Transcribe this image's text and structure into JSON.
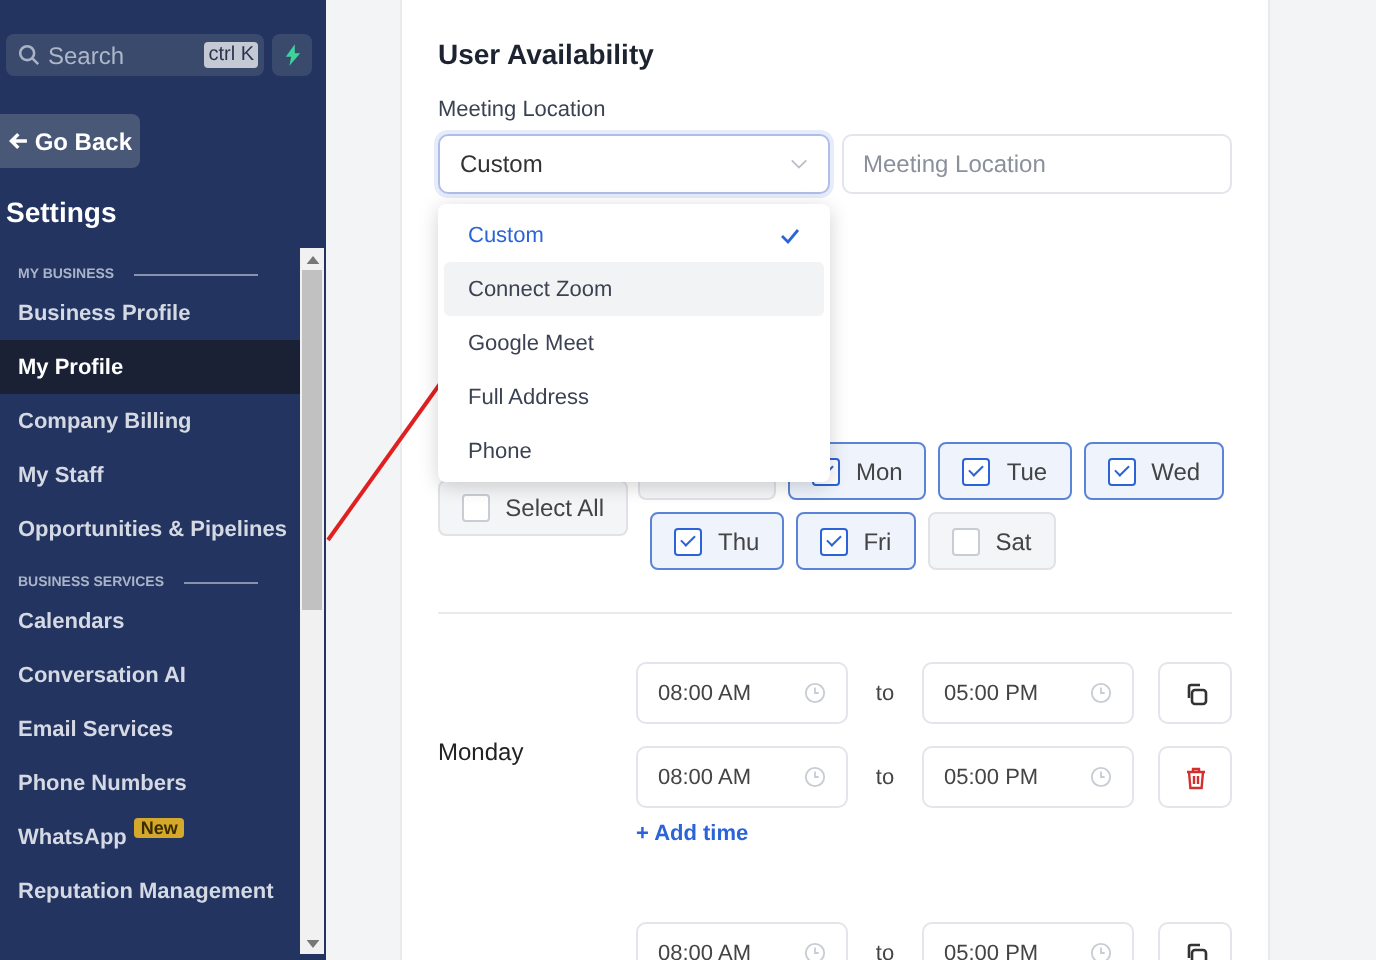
{
  "sidebar": {
    "search": {
      "placeholder": "Search",
      "shortcut": "ctrl K"
    },
    "back_button": "Go Back",
    "heading": "Settings",
    "sections": [
      {
        "title": "MY BUSINESS",
        "items": [
          {
            "label": "Business Profile",
            "selected": false
          },
          {
            "label": "My Profile",
            "selected": true
          },
          {
            "label": "Company Billing",
            "selected": false
          },
          {
            "label": "My Staff",
            "selected": false
          },
          {
            "label": "Opportunities & Pipelines",
            "selected": false
          }
        ]
      },
      {
        "title": "BUSINESS SERVICES",
        "items": [
          {
            "label": "Calendars",
            "selected": false
          },
          {
            "label": "Conversation AI",
            "selected": false
          },
          {
            "label": "Email Services",
            "selected": false
          },
          {
            "label": "Phone Numbers",
            "selected": false
          },
          {
            "label": "WhatsApp",
            "selected": false,
            "badge": "New"
          },
          {
            "label": "Reputation Management",
            "selected": false
          }
        ]
      }
    ]
  },
  "main": {
    "title": "User Availability",
    "meeting_location": {
      "label": "Meeting Location",
      "select_value": "Custom",
      "input_placeholder": "Meeting Location"
    },
    "dropdown": {
      "options": [
        {
          "label": "Custom",
          "selected": true,
          "highlighted": false
        },
        {
          "label": "Connect Zoom",
          "selected": false,
          "highlighted": true
        },
        {
          "label": "Google Meet",
          "selected": false,
          "highlighted": false
        },
        {
          "label": "Full Address",
          "selected": false,
          "highlighted": false
        },
        {
          "label": "Phone",
          "selected": false,
          "highlighted": false
        }
      ]
    },
    "select_all": {
      "label": "Select All",
      "checked": false
    },
    "days": [
      {
        "label": "Mon",
        "checked": true
      },
      {
        "label": "Tue",
        "checked": true
      },
      {
        "label": "Wed",
        "checked": true
      },
      {
        "label": "Thu",
        "checked": true
      },
      {
        "label": "Fri",
        "checked": true
      },
      {
        "label": "Sat",
        "checked": false
      }
    ],
    "schedule": [
      {
        "day": "Monday",
        "slots": [
          {
            "from": "08:00 AM",
            "separator": "to",
            "to": "05:00 PM",
            "kind": "copy"
          },
          {
            "from": "08:00 AM",
            "separator": "to",
            "to": "05:00 PM",
            "kind": "delete"
          }
        ],
        "add_time": "+ Add time"
      },
      {
        "slots": [
          {
            "from": "08:00 AM",
            "separator": "to",
            "to": "05:00 PM",
            "kind": "copy"
          }
        ]
      }
    ]
  }
}
